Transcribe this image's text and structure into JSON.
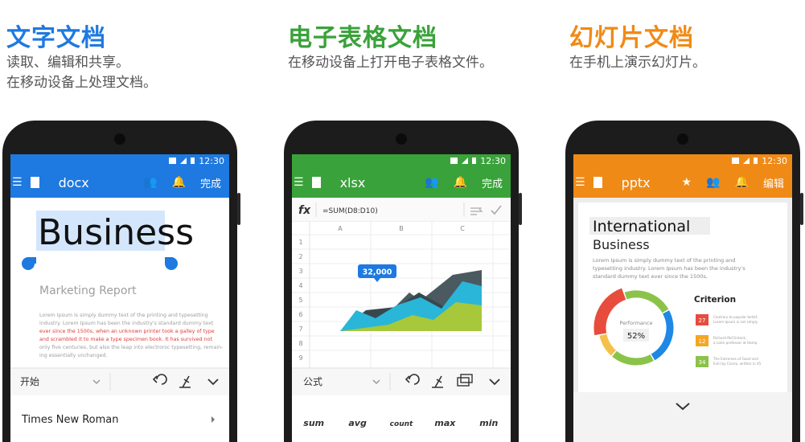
{
  "panels": [
    {
      "heading": "文字文档",
      "heading_color": "#1e79e0",
      "desc1": "读取、编辑和共享。",
      "desc2": "在移动设备上处理文档。",
      "status_time": "12:30",
      "file_name": "docx",
      "done": "完成"
    },
    {
      "heading": "电子表格文档",
      "heading_color": "#3aa23a",
      "desc1": "在移动设备上打开电子表格文件。",
      "status_time": "12:30",
      "file_name": "xlsx",
      "done": "完成"
    },
    {
      "heading": "幻灯片文档",
      "heading_color": "#f08a17",
      "desc1": "在手机上演示幻灯片。",
      "status_time": "12:30",
      "file_name": "pptx",
      "done": "编辑"
    }
  ],
  "doc": {
    "title": "Business",
    "subtitle": "Marketing Report",
    "body_lines": [
      "Lorem Ipsum is simply dummy text of the printing and typesetting",
      "industry. Lorem Ipsum has been the industry's standard dummy text",
      "ever since the 1500s, when an unknown printer took a galley of type",
      "and scrambled it to make a type specimen book. It has survived not",
      "only five centuries, but also the leap into electronic typesetting, remain-",
      "ing essentially unchanged."
    ],
    "highlight_color": "#e53935",
    "toolbar_label": "开始",
    "font_name": "Times New Roman"
  },
  "sheet": {
    "formula_icon": "fx",
    "formula": "=SUM(D8:D10)",
    "columns": [
      "A",
      "B",
      "C"
    ],
    "rows": [
      "1",
      "2",
      "3",
      "4",
      "5",
      "6",
      "7",
      "8",
      "9"
    ],
    "callout": "32,000",
    "toolbar_label": "公式",
    "functions": [
      "sum",
      "avg",
      "count",
      "max",
      "min"
    ],
    "series_colors": [
      "#37474f",
      "#29b6d8",
      "#a6c83a"
    ]
  },
  "slide": {
    "title": "International",
    "subtitle": "Business",
    "body": [
      "Lorem Ipsum is simply dummy text of the printing and",
      "typesetting industry. Lorem Ipsum has been the industry's",
      "standard dummy text ever since the 1500s,"
    ],
    "donut_label": "Performance",
    "donut_value": "52%",
    "criterion_title": "Criterion",
    "criteria": [
      {
        "value": "27",
        "color": "#e74c3c",
        "line1": "Contrary to popular belief,",
        "line2": "Lorem Ipsum is not simply"
      },
      {
        "value": "12",
        "color": "#f5a623",
        "line1": "Richard McClintock,",
        "line2": "a Latin professor at Hamp"
      },
      {
        "value": "34",
        "color": "#8bc34a",
        "line1": "The Extremes of Good and",
        "line2": "Evil) by Cicero, written in 45"
      }
    ]
  }
}
